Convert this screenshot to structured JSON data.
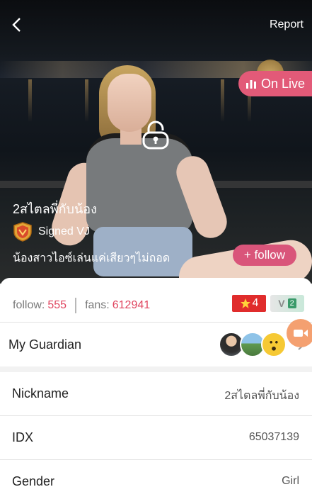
{
  "header": {
    "report_label": "Report"
  },
  "live_badge": {
    "label": "On Live",
    "color": "#e25a78"
  },
  "streamer": {
    "title": "2สไตลพี่กับน้อง",
    "vj_label": "Signed VJ",
    "description": "น้องสาวไอซ์เล่นแค่เสียวๆไม่ถอด",
    "follow_label": "+ follow"
  },
  "stats": {
    "follow_label": "follow:",
    "follow_value": "555",
    "fans_label": "fans:",
    "fans_value": "612941",
    "level_value": "4",
    "vip_label": "V",
    "vip_level": "2"
  },
  "guardian": {
    "label": "My Guardian"
  },
  "profile": [
    {
      "key": "Nickname",
      "value": "2สไตลพี่กับน้อง"
    },
    {
      "key": "IDX",
      "value": "65037139"
    },
    {
      "key": "Gender",
      "value": "Girl"
    }
  ],
  "colors": {
    "accent": "#e0455f",
    "follow_button": "#d9557a",
    "level_badge": "#e02c2c"
  },
  "icons": [
    "back-icon",
    "bars-icon",
    "lock-icon",
    "vj-shield-icon",
    "star-icon",
    "chevron-right-icon",
    "camera-icon"
  ]
}
